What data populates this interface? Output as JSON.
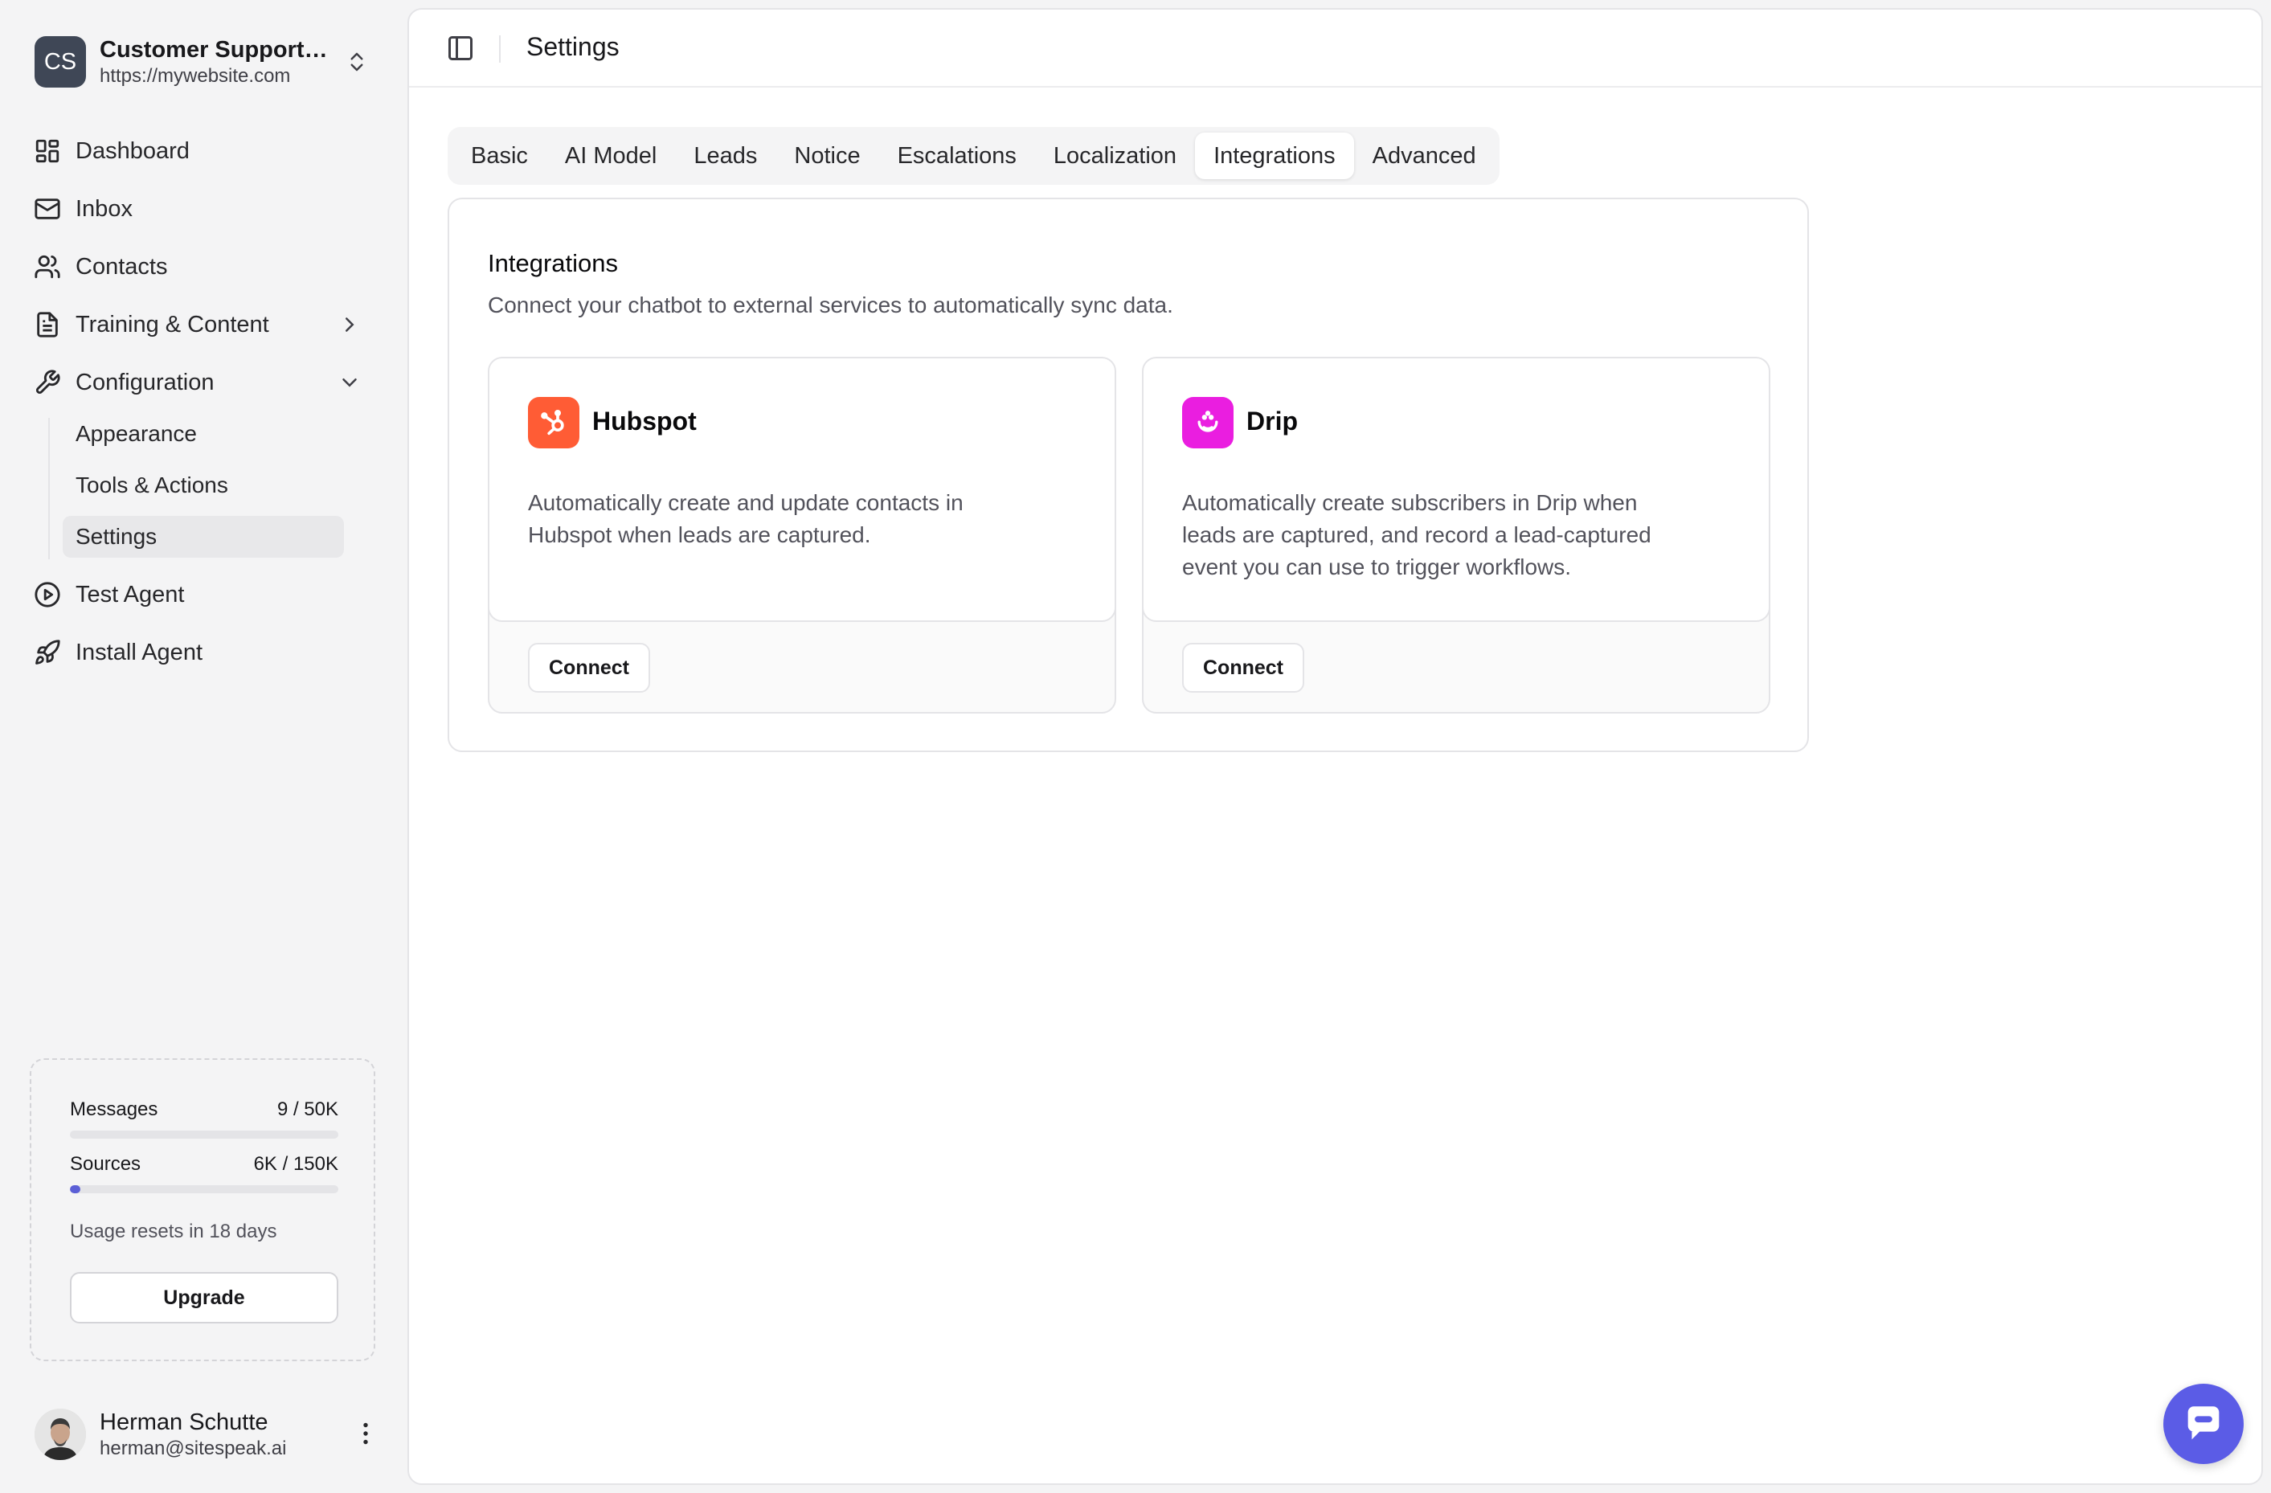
{
  "workspace": {
    "initials": "CS",
    "name": "Customer Support Agent",
    "url": "https://mywebsite.com"
  },
  "nav": {
    "dashboard": "Dashboard",
    "inbox": "Inbox",
    "contacts": "Contacts",
    "training": "Training & Content",
    "configuration": "Configuration",
    "sub": {
      "appearance": "Appearance",
      "tools": "Tools & Actions",
      "settings": "Settings"
    },
    "test": "Test Agent",
    "install": "Install Agent"
  },
  "usage": {
    "messages_label": "Messages",
    "messages_value": "9 / 50K",
    "messages_fraction": 0.0002,
    "sources_label": "Sources",
    "sources_value": "6K / 150K",
    "sources_fraction": 0.04,
    "reset_text": "Usage resets in 18 days",
    "upgrade_label": "Upgrade"
  },
  "user": {
    "name": "Herman Schutte",
    "email": "herman@sitespeak.ai"
  },
  "header": {
    "title": "Settings"
  },
  "tabs": [
    "Basic",
    "AI Model",
    "Leads",
    "Notice",
    "Escalations",
    "Localization",
    "Integrations",
    "Advanced"
  ],
  "active_tab": "Integrations",
  "section": {
    "title": "Integrations",
    "description": "Connect your chatbot to external services to automatically sync data."
  },
  "integrations": [
    {
      "name": "Hubspot",
      "icon": "hubspot-icon",
      "color": "#ff5c35",
      "description": "Automatically create and update contacts in Hubspot when leads are captured.",
      "button": "Connect"
    },
    {
      "name": "Drip",
      "icon": "drip-icon",
      "color": "#ea1ee0",
      "description": "Automatically create subscribers in Drip when leads are captured, and record a lead-captured event you can use to trigger workflows.",
      "button": "Connect"
    }
  ],
  "colors": {
    "accent": "#5b5ce6",
    "hubspot": "#ff5c35",
    "drip": "#ea1ee0"
  }
}
